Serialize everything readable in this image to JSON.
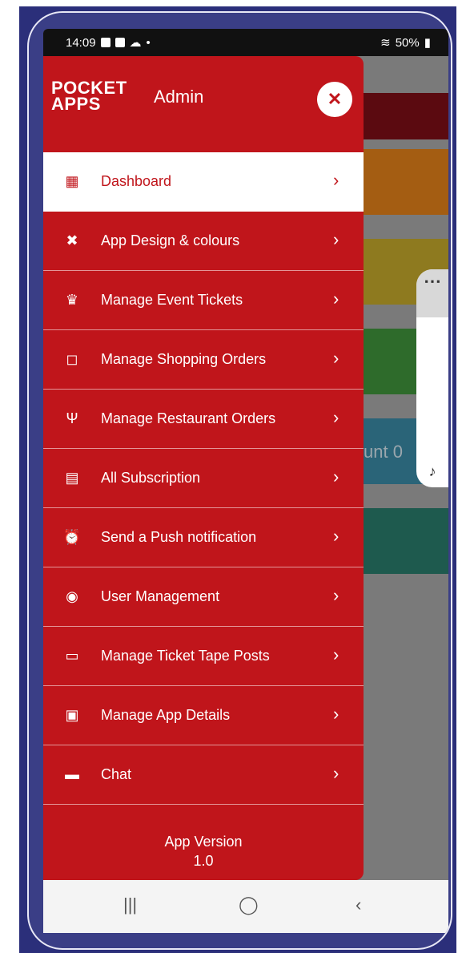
{
  "status_bar": {
    "time": "14:09",
    "battery": "50%"
  },
  "header": {
    "logo_line1": "POCKET",
    "logo_line2": "APPS",
    "title": "Admin",
    "close_icon": "close-icon"
  },
  "menu": [
    {
      "label": "Dashboard",
      "icon": "grid-icon",
      "active": true
    },
    {
      "label": "App Design & colours",
      "icon": "tools-icon"
    },
    {
      "label": "Manage Event Tickets",
      "icon": "trophy-icon"
    },
    {
      "label": "Manage Shopping Orders",
      "icon": "bag-icon"
    },
    {
      "label": "Manage Restaurant Orders",
      "icon": "utensils-icon"
    },
    {
      "label": "All Subscription",
      "icon": "subscription-icon"
    },
    {
      "label": "Send a Push notification",
      "icon": "alarm-icon"
    },
    {
      "label": "User Management",
      "icon": "palette-icon"
    },
    {
      "label": "Manage Ticket Tape Posts",
      "icon": "folder-icon"
    },
    {
      "label": "Manage App Details",
      "icon": "app-details-icon"
    },
    {
      "label": "Chat",
      "icon": "chat-icon"
    }
  ],
  "footer": {
    "version_label": "App Version",
    "version_number": "1.0"
  },
  "background": {
    "partial_text": "unt 0"
  },
  "colors": {
    "drawer": "#c0151b",
    "active_bg": "#ffffff",
    "frame": "#2b2f7a"
  }
}
